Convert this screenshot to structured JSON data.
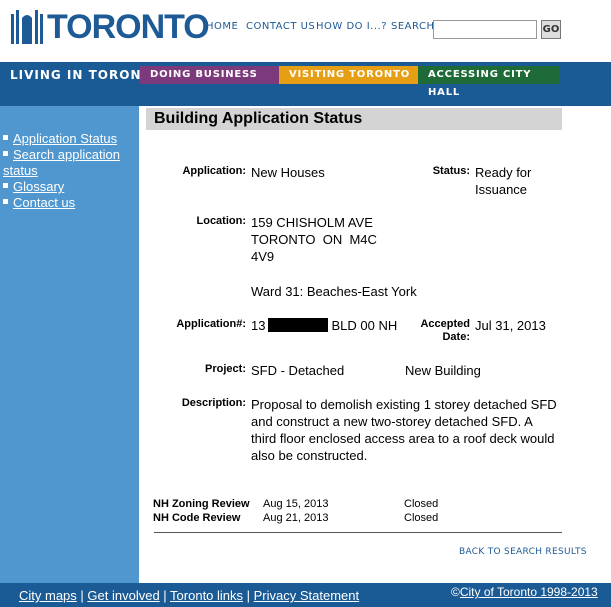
{
  "header": {
    "logo_text": "TORONTO",
    "nav": [
      "HOME",
      "CONTACT US",
      "HOW DO I...?"
    ],
    "search_label": "SEARCH:",
    "search_value": "",
    "go_label": "GO"
  },
  "mainnav": {
    "living": "LIVING IN TORONTO",
    "tabs": [
      "DOING BUSINESS",
      "VISITING TORONTO",
      "ACCESSING CITY HALL"
    ]
  },
  "sidebar": {
    "items": [
      {
        "label": "Application Status"
      },
      {
        "label": "Search application status"
      },
      {
        "label": "Glossary"
      },
      {
        "label": "Contact us"
      }
    ]
  },
  "page": {
    "title": "Building Application Status",
    "application_label": "Application:",
    "application_value": "New Houses",
    "status_label": "Status:",
    "status_line1": "Ready for",
    "status_line2": "Issuance",
    "location_label": "Location:",
    "location_line1": "159 CHISHOLM AVE",
    "location_line2": "TORONTO  ON  M4C",
    "location_line3": "4V9",
    "ward": "Ward 31: Beaches-East York",
    "appnum_label": "Application#:",
    "appnum_prefix": "13",
    "appnum_suffix": "BLD 00 NH",
    "accepted_label1": "Accepted",
    "accepted_label2": "Date:",
    "accepted_value": "Jul 31, 2013",
    "project_label": "Project:",
    "project_value1": "SFD - Detached",
    "project_value2": "New Building",
    "description_label": "Description:",
    "description_lines": [
      "Proposal to demolish existing 1 storey detached SFD",
      "and construct a new two-storey detached SFD. A",
      "third floor enclosed access area to a roof deck would",
      "also be constructed."
    ],
    "reviews": [
      {
        "name": "NH Zoning Review",
        "date": "Aug 15, 2013",
        "status": "Closed"
      },
      {
        "name": "NH Code Review",
        "date": "Aug 21, 2013",
        "status": "Closed"
      }
    ],
    "back_link": "BACK TO SEARCH RESULTS"
  },
  "footer": {
    "links": [
      "City maps",
      "Get involved",
      "Toronto links",
      "Privacy Statement"
    ],
    "separator": " | ",
    "copyright_symbol": "©",
    "copyright_link": "City of Toronto 1998-2013"
  },
  "colors": {
    "brand_blue": "#1b5b95",
    "sidebar_blue": "#5097cf",
    "business_purple": "#7c3a7d",
    "visiting_orange": "#e69e15",
    "cityhall_green": "#1f6b37"
  }
}
